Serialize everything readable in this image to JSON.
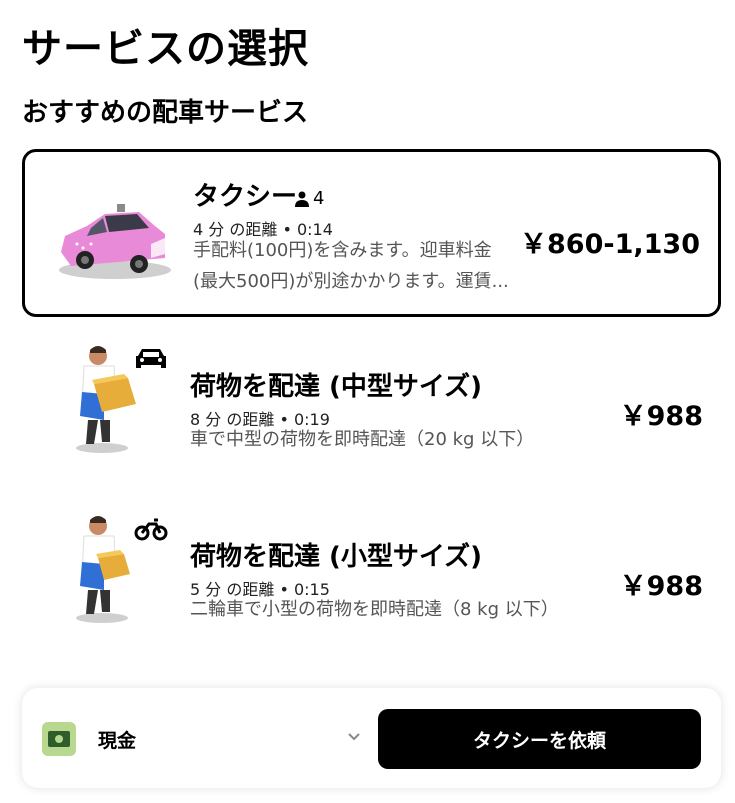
{
  "page": {
    "title": "サービスの選択",
    "section_title": "おすすめの配車サービス"
  },
  "options": [
    {
      "name": "タクシー",
      "capacity": "4",
      "meta": "4 分 の距離 • 0:14",
      "desc_line1": "手配料(100円)を含みます。迎車料金",
      "desc_line2": "(最大500円)が別途かかります。運賃...",
      "price": "￥860-1,130",
      "image": "pink-taxi-car",
      "selected": true
    },
    {
      "name": "荷物を配達 (中型サイズ)",
      "meta": "8 分 の距離 • 0:19",
      "desc_line1": "車で中型の荷物を即時配達（20 kg 以下）",
      "price": "￥988",
      "image": "courier-person",
      "type_icon": "car-icon"
    },
    {
      "name": "荷物を配達 (小型サイズ)",
      "meta": "5 分 の距離 • 0:15",
      "desc_line1": "二輪車で小型の荷物を即時配達（8 kg 以下）",
      "price": "￥988",
      "image": "courier-person",
      "type_icon": "motorbike-icon"
    }
  ],
  "footer": {
    "payment_label": "現金",
    "payment_icon": "cash-icon",
    "request_button": "タクシーを依頼"
  },
  "colors": {
    "accent": "#000000",
    "taxi": "#e98ad8",
    "cash_icon_bg": "#b8d88f"
  }
}
